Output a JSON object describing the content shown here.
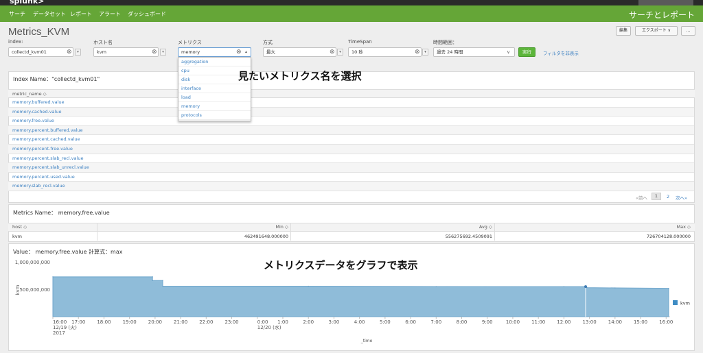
{
  "topbar": {
    "logo": "splunk>"
  },
  "nav": {
    "items": [
      "サーチ",
      "データセット",
      "レポート",
      "アラート",
      "ダッシュボード"
    ],
    "app_title": "サーチとレポート"
  },
  "page": {
    "title": "Metrics_KVM",
    "edit_label": "編集",
    "export_label": "エクスポート ∨",
    "more_label": "..."
  },
  "inputs": {
    "index_label": "index:",
    "index_value": "collectd_kvm01",
    "host_label": "ホスト名",
    "host_value": "kvm",
    "metric_label": "メトリクス",
    "metric_value": "memory",
    "method_label": "方式",
    "method_value": "最大",
    "timespan_label": "TimeSpan",
    "timespan_value": "10 秒",
    "range_label": "時間範囲：",
    "range_value": "過去 24 時間",
    "run_label": "実行",
    "hide_filter_label": "フィルタを非表示"
  },
  "dropdown": {
    "options": [
      "aggregation",
      "cpu",
      "disk",
      "interface",
      "load",
      "memory",
      "protocols"
    ]
  },
  "annotations": {
    "select_metric": "見たいメトリクス名を選択",
    "graph_display": "メトリクスデータをグラフで表示"
  },
  "index_panel": {
    "title": "Index Name：\"collectd_kvm01\"",
    "column": "metric_name ◇",
    "rows": [
      "memory.buffered.value",
      "memory.cached.value",
      "memory.free.value",
      "memory.percent.buffered.value",
      "memory.percent.cached.value",
      "memory.percent.free.value",
      "memory.percent.slab_recl.value",
      "memory.percent.slab_unrecl.value",
      "memory.percent.used.value",
      "memory.slab_recl.value"
    ],
    "pager_prev": "«前へ",
    "pager_page1": "1",
    "pager_page2": "2",
    "pager_next": "次へ»"
  },
  "metrics_panel": {
    "title": "Metrics Name： memory.free.value",
    "columns": [
      "host ◇",
      "Min ◇",
      "Avg ◇",
      "Max ◇"
    ],
    "row": [
      "kvm",
      "462491648.000000",
      "556275692.4509091",
      "726704128.000000"
    ]
  },
  "chart_panel": {
    "title": "Value： memory.free.value 計算式：max"
  },
  "chart_data": {
    "type": "area",
    "title": "Value： memory.free.value 計算式：max",
    "xlabel": "_time",
    "ylabel": "kvm",
    "ylim": [
      0,
      1000000000
    ],
    "y_ticks": [
      "1,000,000,000",
      "500,000,000"
    ],
    "x_tick_labels": [
      "16:00",
      "17:00",
      "18:00",
      "19:00",
      "20:00",
      "21:00",
      "22:00",
      "23:00",
      "0:00",
      "1:00",
      "2:00",
      "3:00",
      "4:00",
      "5:00",
      "6:00",
      "7:00",
      "8:00",
      "9:00",
      "10:00",
      "11:00",
      "12:00",
      "13:00",
      "14:00",
      "15:00",
      "16:00"
    ],
    "x_subtick_1": "12/19 (火)",
    "x_subtick_1b": "2017",
    "x_subtick_2": "12/20 (水)",
    "legend": "kvm",
    "legend_placement": "right",
    "color": "#8fbcd9",
    "series": [
      {
        "name": "kvm",
        "x": [
          0,
          3.9,
          3.9,
          4.3,
          4.3,
          10,
          15,
          20,
          20.85,
          20.9,
          22,
          24.1
        ],
        "values": [
          726704128,
          726704128,
          660000000,
          660000000,
          556000000,
          556000000,
          550000000,
          548000000,
          548000000,
          530000000,
          525000000,
          518000000
        ]
      }
    ]
  }
}
